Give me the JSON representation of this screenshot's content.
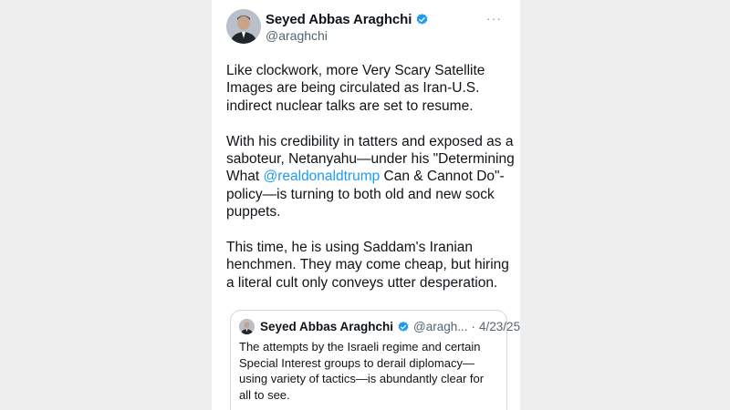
{
  "tweet": {
    "author_name": "Seyed Abbas Araghchi",
    "handle": "@araghchi",
    "more_icon": "···",
    "paragraph1": "Like clockwork, more Very Scary Satellite Images are being circulated as Iran-U.S. indirect nuclear talks are set to resume.",
    "paragraph2_before": "With his credibility in tatters and exposed as a saboteur, Netanyahu—under his \"Determining What ",
    "paragraph2_mention": "@realdonaldtrump",
    "paragraph2_after": " Can & Cannot Do\"-policy—is turning to both old and new sock puppets.",
    "paragraph3": "This time, he is using Saddam's Iranian henchmen. They may come cheap, but hiring a literal cult only conveys utter desperation."
  },
  "quote": {
    "author_name": "Seyed Abbas Araghchi",
    "handle": "@aragh...",
    "separator": "·",
    "date": "4/23/25",
    "text": "The attempts by the Israeli regime and certain Special Interest groups to derail diplomacy—using variety of tactics—is abundantly clear for all to see."
  },
  "colors": {
    "verified": "#1d9bf0",
    "mention": "#1d9bf0",
    "secondary_text": "#536471",
    "border": "#cfd9de"
  }
}
